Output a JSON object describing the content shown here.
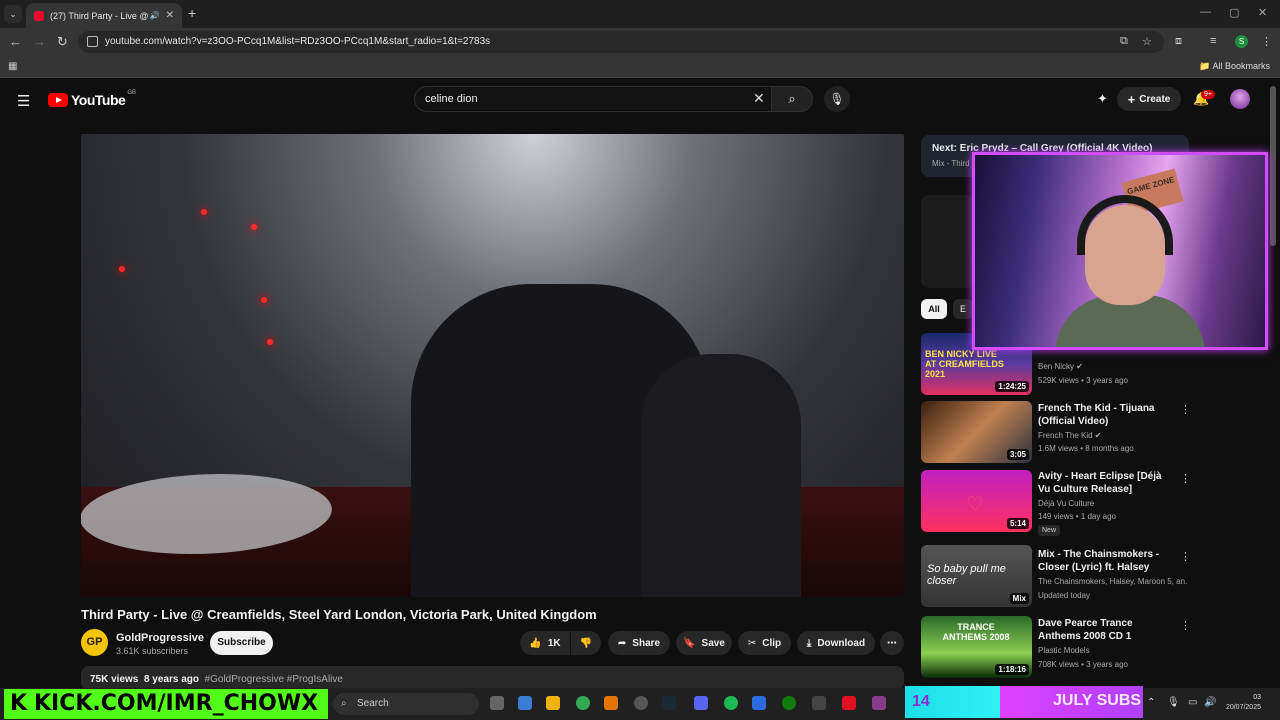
{
  "browser": {
    "tab_title": "(27) Third Party - Live @ Cr",
    "url": "youtube.com/watch?v=z3OO-PCcq1M&list=RDz3OO-PCcq1M&start_radio=1&t=2783s",
    "bookmarks_label": "All Bookmarks",
    "profile_initial": "S"
  },
  "youtube": {
    "logo_text": "YouTube",
    "country_code": "GB",
    "search_value": "celine dion",
    "create_label": "Create",
    "notif_count": "9+"
  },
  "video": {
    "title": "Third Party - Live @ Creamfields, Steel Yard London, Victoria Park, United Kingdom",
    "channel_initials": "GP",
    "channel_name": "GoldProgressive",
    "subscribers": "3.61K subscribers",
    "subscribe_label": "Subscribe",
    "likes": "1K",
    "share_label": "Share",
    "save_label": "Save",
    "clip_label": "Clip",
    "download_label": "Download",
    "views": "75K views",
    "age": "8 years ago",
    "tags": "#GoldProgressive #ProgIsAlive"
  },
  "sidebar": {
    "next_title": "Next: Eric Prydz – Call Grey (Official 4K Video)",
    "next_sub": "Mix - Third P",
    "chip_all": "All",
    "chip_two": "E",
    "recommendations": [
      {
        "title": "",
        "channel": "Ben Nicky",
        "meta": "529K views • 3 years ago",
        "duration": "1:24:25",
        "thumb_text": "BEN NICKY LIVE AT CREAMFIELDS 2021"
      },
      {
        "title": "French The Kid - Tijuana (Official Video)",
        "channel": "French The Kid",
        "meta": "1.6M views • 8 months ago",
        "duration": "3:05"
      },
      {
        "title": "Avity - Heart Eclipse [Déjà Vu Culture Release]",
        "channel": "Déjà Vu Culture",
        "meta": "149 views • 1 day ago",
        "duration": "5:14",
        "badge": "New"
      },
      {
        "title": "Mix - The Chainsmokers - Closer (Lyric) ft. Halsey",
        "channel": "The Chainsmokers, Halsey, Maroon 5, an...",
        "meta": "Updated today",
        "duration": "Mix",
        "thumb_text": "So baby pull me closer"
      },
      {
        "title": "Dave Pearce  Trance Anthems 2008 CD 1",
        "channel": "Plastic Models",
        "meta": "708K views • 3 years ago",
        "duration": "1:18:16",
        "thumb_text": "TRANCE ANTHEMS 2008"
      }
    ]
  },
  "webcam": {
    "sign_text": "GAME ZONE"
  },
  "taskbar": {
    "kick_text": "KICK.COM/IMR_CHOWX",
    "search_label": "Search",
    "subs_count": "14",
    "subs_label": "JULY SUBS",
    "time": "03",
    "date": "20/07/2025"
  },
  "colors": {
    "yt_red": "#ff0000",
    "kick_green": "#53fc18",
    "overlay_purple": "#d24dff",
    "overlay_cyan": "#1ddfe8"
  }
}
